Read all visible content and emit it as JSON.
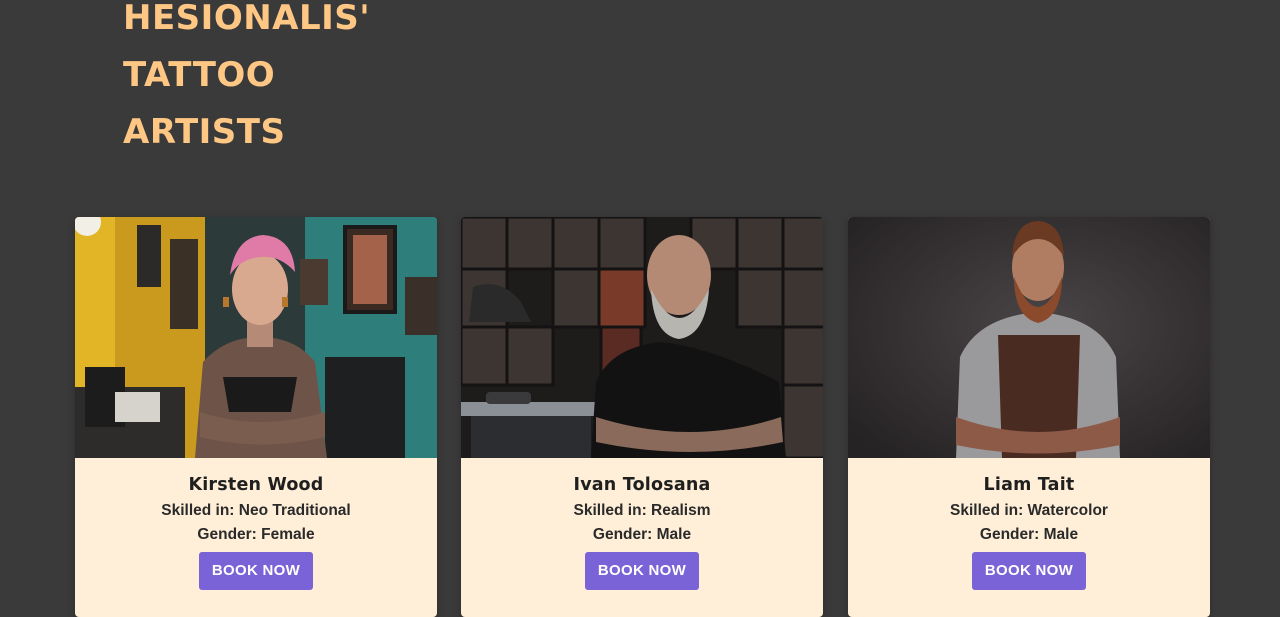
{
  "hero": {
    "heading_lines": [
      "HESIONALIS'",
      "TATTOO",
      "ARTISTS"
    ]
  },
  "artists": [
    {
      "name": "Kirsten Wood",
      "skill": "Skilled in: Neo Traditional",
      "gender": "Gender: Female",
      "button": "BOOK NOW"
    },
    {
      "name": "Ivan Tolosana",
      "skill": "Skilled in: Realism",
      "gender": "Gender: Male",
      "button": "BOOK NOW"
    },
    {
      "name": "Liam Tait",
      "skill": "Skilled in: Watercolor",
      "gender": "Gender: Male",
      "button": "BOOK NOW"
    }
  ],
  "colors": {
    "page_background": "#3b3a3a",
    "heading": "#ffc784",
    "card_background": "#ffefd8",
    "button": "#7a63d6"
  }
}
